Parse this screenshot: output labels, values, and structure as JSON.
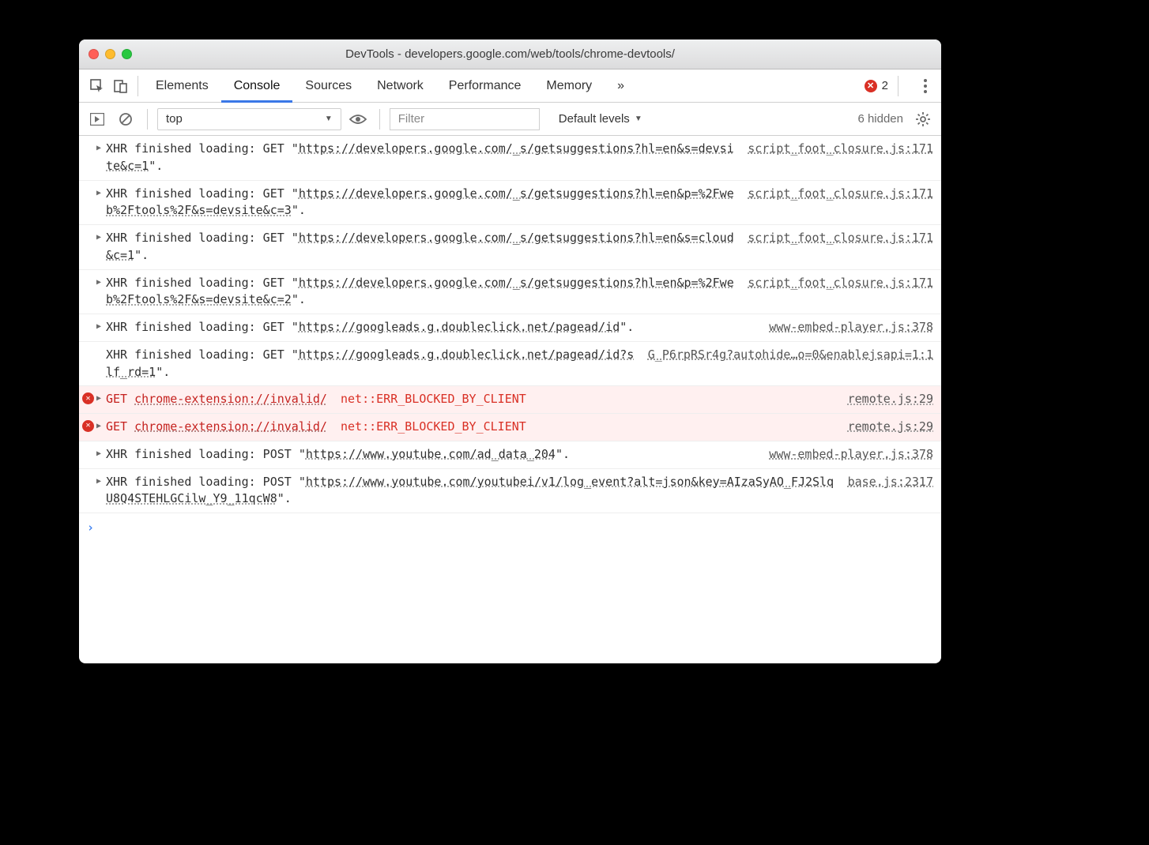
{
  "window": {
    "title": "DevTools - developers.google.com/web/tools/chrome-devtools/"
  },
  "tabs": {
    "items": [
      "Elements",
      "Console",
      "Sources",
      "Network",
      "Performance",
      "Memory"
    ],
    "active": 1,
    "overflow": "»",
    "errorCount": "2"
  },
  "toolbar": {
    "context": "top",
    "filterPlaceholder": "Filter",
    "levels": "Default levels",
    "hidden": "6 hidden"
  },
  "logs": [
    {
      "type": "xhr",
      "prefix": "XHR finished loading: GET \"",
      "url": "https://developers.google.com/_s/getsuggestions?hl=en&s=devsite&c=1",
      "suffix": "\".",
      "source": "script_foot_closure.js:171",
      "disclosure": true
    },
    {
      "type": "xhr",
      "prefix": "XHR finished loading: GET \"",
      "url": "https://developers.google.com/_s/getsuggestions?hl=en&p=%2Fweb%2Ftools%2F&s=devsite&c=3",
      "suffix": "\".",
      "source": "script_foot_closure.js:171",
      "disclosure": true
    },
    {
      "type": "xhr",
      "prefix": "XHR finished loading: GET \"",
      "url": "https://developers.google.com/_s/getsuggestions?hl=en&s=cloud&c=1",
      "suffix": "\".",
      "source": "script_foot_closure.js:171",
      "disclosure": true
    },
    {
      "type": "xhr",
      "prefix": "XHR finished loading: GET \"",
      "url": "https://developers.google.com/_s/getsuggestions?hl=en&p=%2Fweb%2Ftools%2F&s=devsite&c=2",
      "suffix": "\".",
      "source": "script_foot_closure.js:171",
      "disclosure": true
    },
    {
      "type": "xhr",
      "prefix": "XHR finished loading: GET \"",
      "url": "https://googleads.g.doubleclick.net/pagead/id",
      "suffix": "\".",
      "source": "www-embed-player.js:378",
      "disclosure": true
    },
    {
      "type": "xhr",
      "prefix": "XHR finished loading: GET \"",
      "url": "https://googleads.g.doubleclick.net/pagead/id?slf_rd=1",
      "suffix": "\".",
      "source": "G_P6rpRSr4g?autohide…o=0&enablejsapi=1:1",
      "disclosure": false
    },
    {
      "type": "error",
      "method": "GET",
      "url": "chrome-extension://invalid/",
      "err": "net::ERR_BLOCKED_BY_CLIENT",
      "source": "remote.js:29",
      "disclosure": true
    },
    {
      "type": "error",
      "method": "GET",
      "url": "chrome-extension://invalid/",
      "err": "net::ERR_BLOCKED_BY_CLIENT",
      "source": "remote.js:29",
      "disclosure": true
    },
    {
      "type": "xhr",
      "prefix": "XHR finished loading: POST \"",
      "url": "https://www.youtube.com/ad_data_204",
      "suffix": "\".",
      "source": "www-embed-player.js:378",
      "disclosure": true
    },
    {
      "type": "xhr",
      "prefix": "XHR finished loading: POST \"",
      "url": "https://www.youtube.com/youtubei/v1/log_event?alt=json&key=AIzaSyAO_FJ2SlqU8Q4STEHLGCilw_Y9_11qcW8",
      "suffix": "\".",
      "source": "base.js:2317",
      "disclosure": true
    }
  ],
  "prompt": "›"
}
